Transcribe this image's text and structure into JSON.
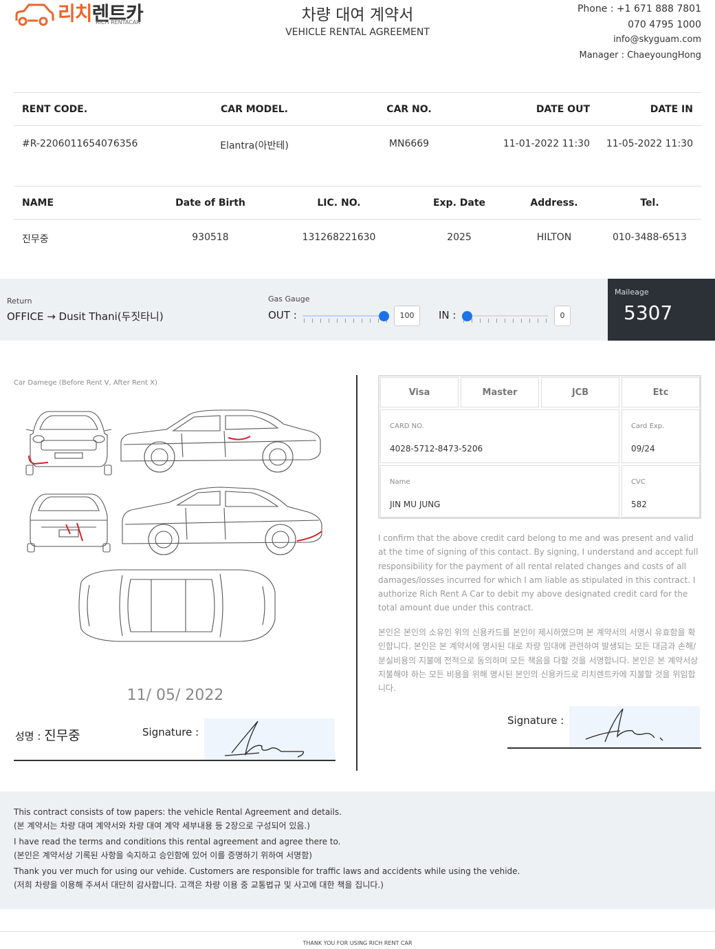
{
  "header": {
    "logo_ko_a": "리치",
    "logo_ko_b": "렌트카",
    "logo_en": "RICH RENTACAR",
    "title_ko": "차량 대여 계약서",
    "title_en": "VEHICLE RENTAL AGREEMENT",
    "phone1": "Phone : +1 671 888 7801",
    "phone2": "070 4795 1000",
    "email": "info@skyguam.com",
    "manager": "Manager : ChaeyoungHong"
  },
  "rental": {
    "headers": [
      "RENT CODE.",
      "CAR MODEL.",
      "CAR NO.",
      "DATE OUT",
      "DATE IN"
    ],
    "values": [
      "#R-2206011654076356",
      "Elantra(아반테)",
      "MN6669",
      "11-01-2022 11:30",
      "11-05-2022 11:30"
    ]
  },
  "renter": {
    "headers": [
      "NAME",
      "Date of Birth",
      "LIC. NO.",
      "Exp. Date",
      "Address.",
      "Tel."
    ],
    "values": [
      "진무중",
      "930518",
      "131268221630",
      "2025",
      "HILTON",
      "010-3488-6513"
    ]
  },
  "status": {
    "return_label": "Return",
    "return_value": "OFFICE → Dusit Thani(두짓타니)",
    "gas_label": "Gas Gauge",
    "out_label": "OUT :",
    "out_value": "100",
    "out_level": 1.0,
    "in_label": "IN :",
    "in_value": "0",
    "in_level": 0.0,
    "mileage_label": "Maileage",
    "mileage_value": "5307"
  },
  "damage": {
    "label": "Car Damege (Before Rent V, After Rent X)",
    "date": "11/ 05/ 2022",
    "name_label": "성명 :",
    "name_value": "진무중",
    "signature_label": "Signature :"
  },
  "card": {
    "brands": [
      "Visa",
      "Master",
      "JCB",
      "Etc"
    ],
    "card_no_label": "CARD NO.",
    "card_no": "4028-5712-8473-5206",
    "exp_label": "Card Exp.",
    "exp": "09/24",
    "name_label": "Name",
    "name": "JIN MU JUNG",
    "cvc_label": "CVC",
    "cvc": "582",
    "consent_en": "I confirm that the above credit card belong to me and was present and valid at the time of signing of this contact. By signing, I understand and accept full responsibility for the payment of all rental related changes and costs of all damages/losses incurred for which I am liable as stipulated in this contract. I authorize Rich Rent A Car to debit my above designated credit card for the total amount due under this contract.",
    "consent_ko": "본인은 본인의 소유인 위의 신용카드를 본인이 제시하였으며 본 계약서의 서명시 유효함을 확인합니다. 본인은 본 계약서에 명시된 대로 차량 임대에 관련하여 발생되는 모든 대금과 손해/분실비용의 지불에 전적으로 동의하며 모든 책음을 다할 것을 서명합니다. 본인은 본 계약서상 지불해야 하는 모든 비용을 위해 명시된 본인의 신용카드로 리치렌트카에 지불할 것을 위임합니다.",
    "signature_label": "Signature :"
  },
  "footer": {
    "lines": [
      "This contract consists of tow papers: the vehicle Rental Agreement and details.",
      "(본 계약서는 차량 대여 계약서와 차량 대여 계약 세부내용 등 2장으로 구성되어 있음.)",
      "I have read the terms and conditions this rental agreement and agree there to.",
      "(본인은 계약서상 기록된 사항을 숙지하고 승인함에 있어 이를 증명하기 위하여 서명함)",
      "Thank you ver much for using our vehide. Customers are responsible for traffic laws and accidents while using the vehide.",
      "(저희 차량을 이용해 주셔서 대단히 감사합니다. 고객은 차량 이용 중 교통법규 및 사고에 대한 책을 집니다.)"
    ],
    "thanks": "THANK YOU FOR USING RICH RENT CAR"
  },
  "colors": {
    "brand_orange": "#e9652a",
    "slider_blue": "#1a73e8",
    "mileage_bg": "#2b3137",
    "band_bg": "#eef1f3",
    "damage_red": "#d8202a"
  }
}
